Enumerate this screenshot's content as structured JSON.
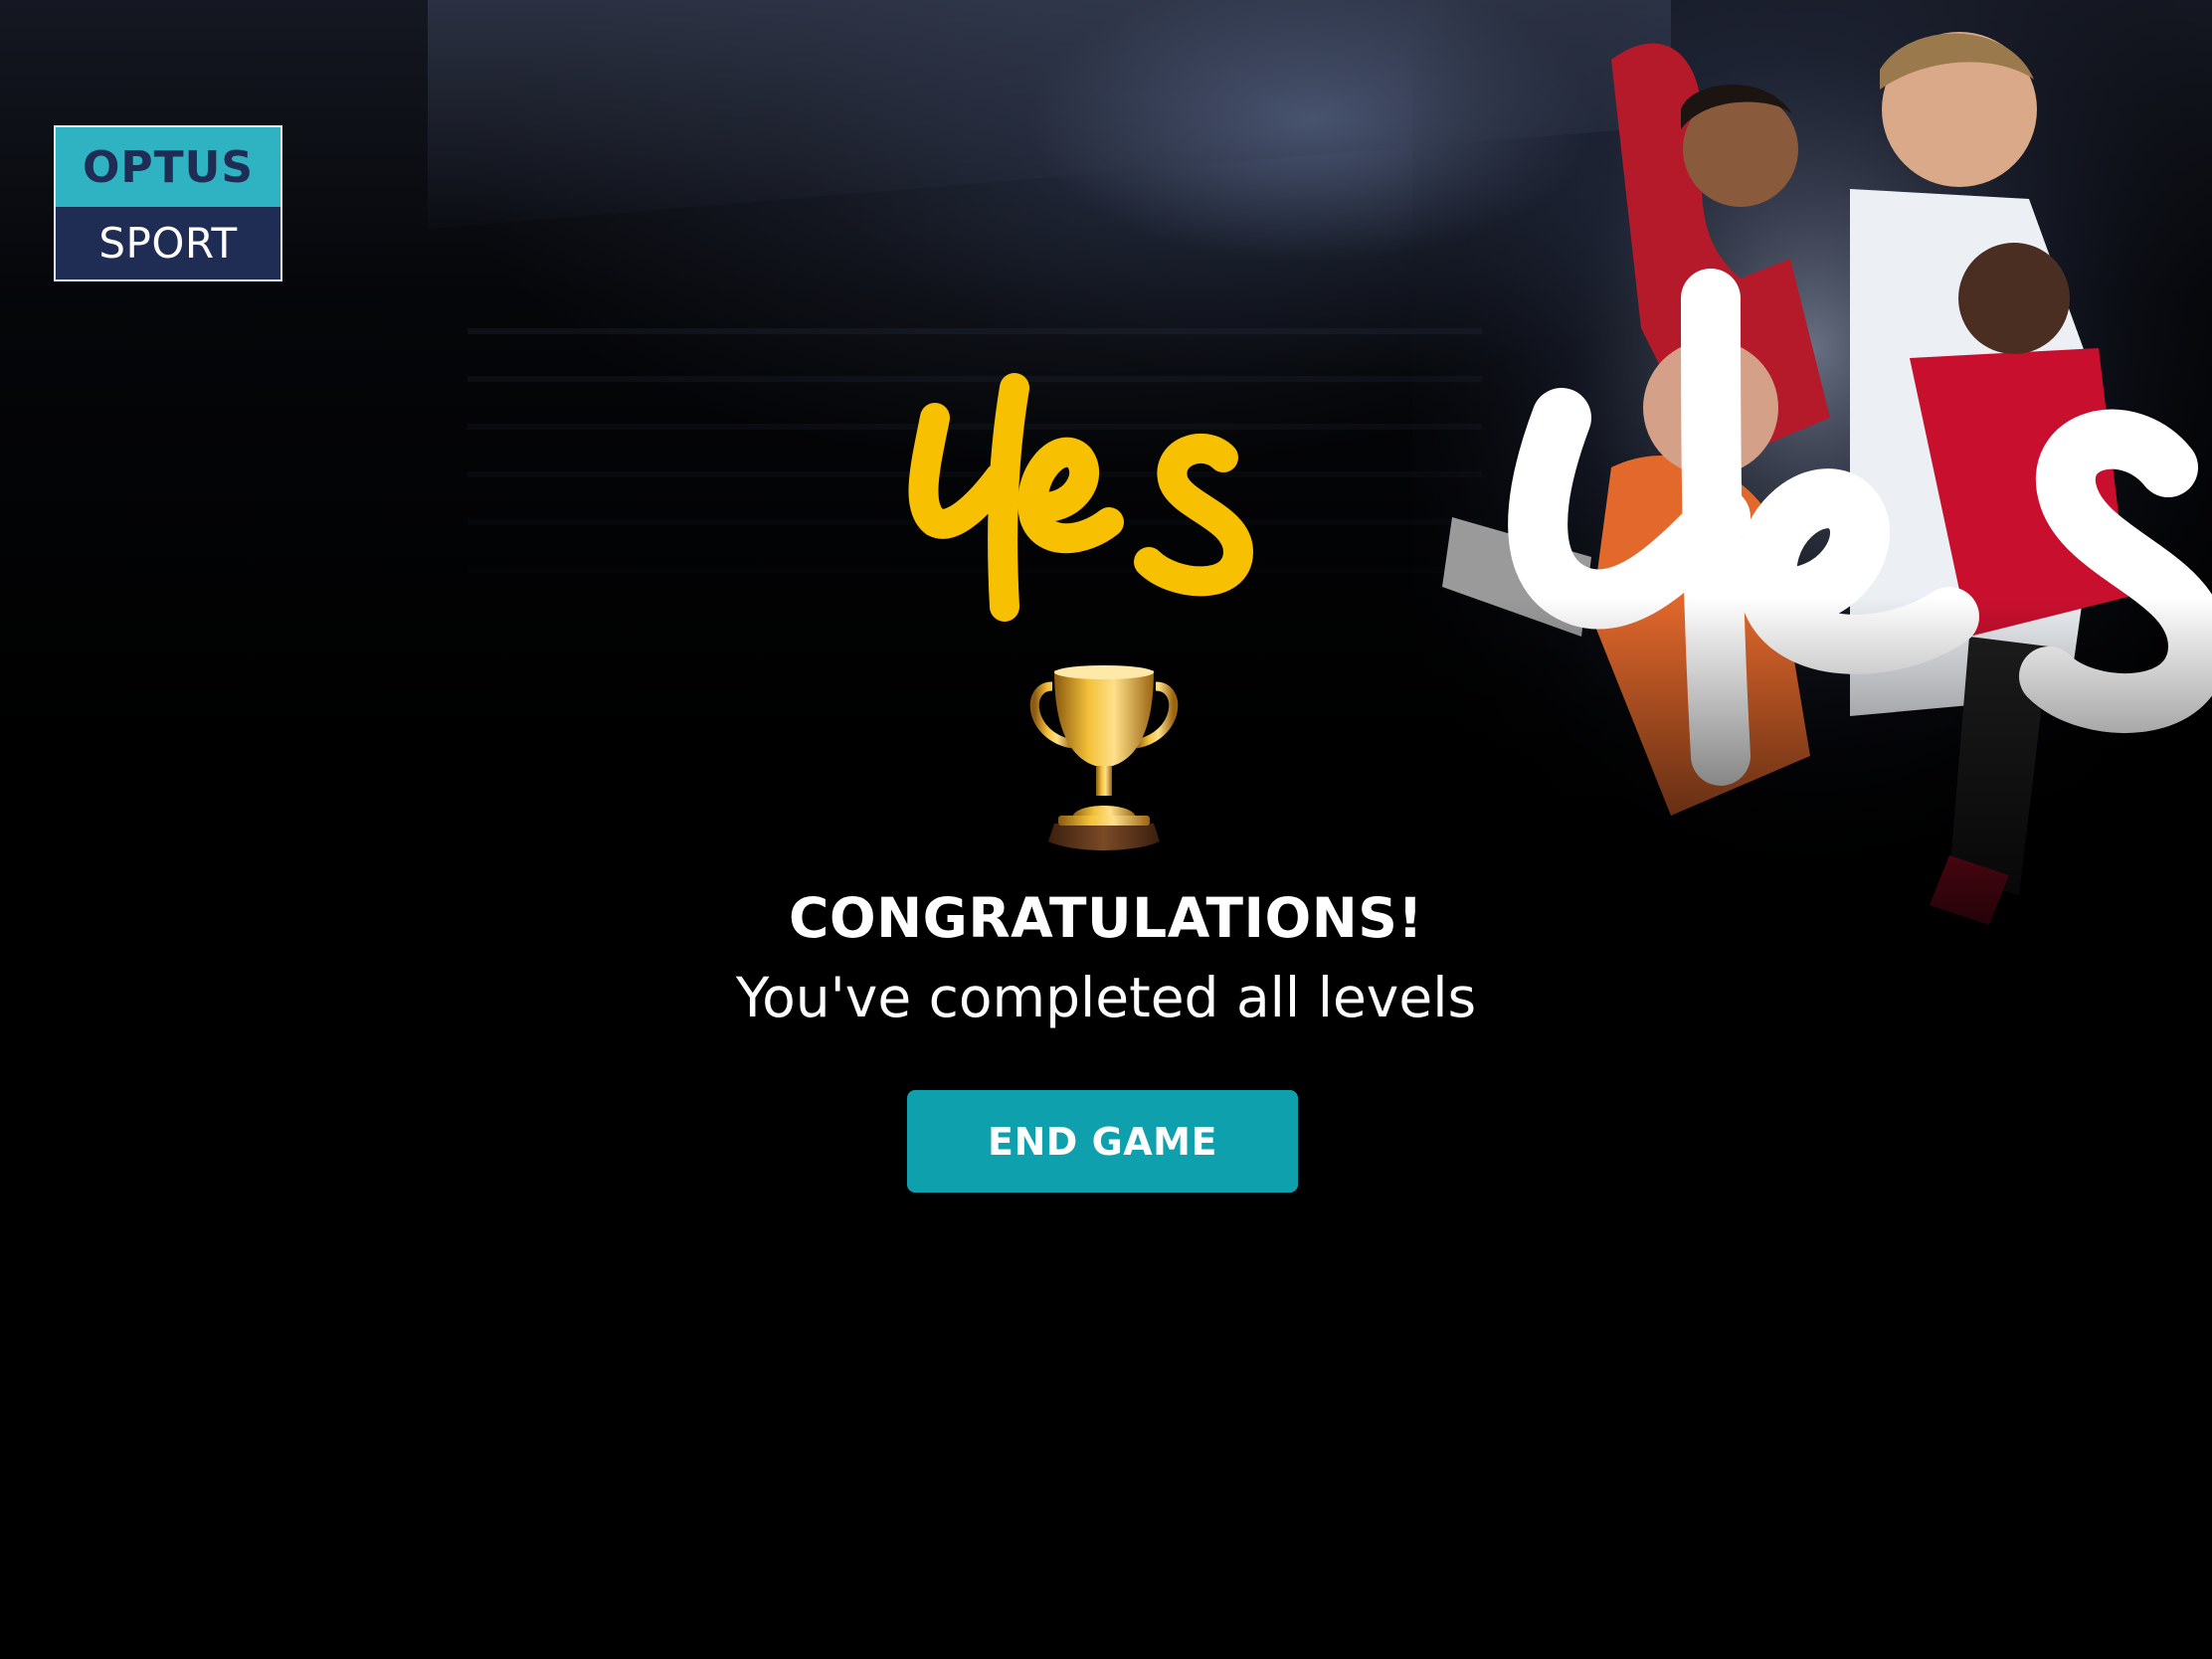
{
  "brand": {
    "logo_top": "OPTUS",
    "logo_bottom": "SPORT",
    "logo_top_color": "#2fb2c2",
    "logo_bottom_color": "#1f2d55"
  },
  "promo": {
    "yes_color": "#f7c000",
    "yes_white_color": "#ffffff"
  },
  "result": {
    "icon": "trophy-icon",
    "headline": "CONGRATULATIONS!",
    "message": "You've completed all levels"
  },
  "actions": {
    "end_game_label": "END GAME",
    "end_game_color": "#0ea1ad"
  }
}
